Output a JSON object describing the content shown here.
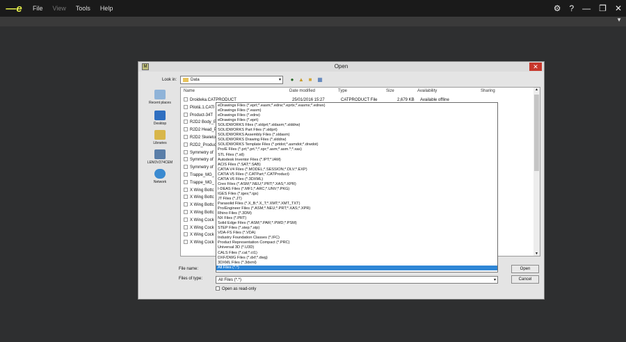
{
  "app": {
    "logo_text": "e",
    "menus": [
      "File",
      "View",
      "Tools",
      "Help"
    ],
    "window_controls": [
      "⚙",
      "?",
      "—",
      "❐",
      "✕"
    ],
    "colors": {
      "logo": "#e7f04a",
      "selection": "#2f86d6",
      "close_button": "#c7372b"
    }
  },
  "dialog": {
    "title": "Open",
    "look_in_label": "Look in:",
    "look_in_value": "Data",
    "toolbar_icons": [
      "back-icon",
      "up-folder-icon",
      "new-folder-icon",
      "view-menu-icon"
    ],
    "places": [
      "Recent places",
      "Desktop",
      "Libraries",
      "LENOV274CEM",
      "Network"
    ],
    "columns": [
      "Name",
      "Date modified",
      "Type",
      "Size",
      "Availability",
      "Sharing"
    ],
    "files": [
      {
        "name": "Droideka.CATPRODUCT",
        "date": "25/01/2016 15:27",
        "type": "CATPRODUCT File",
        "size": "2,679 KB",
        "availability": "Available offline"
      },
      {
        "name": "Pilot&.1.CATI"
      },
      {
        "name": "Product-34T"
      },
      {
        "name": "R2D2 Body_P"
      },
      {
        "name": "R2D2 Head_P"
      },
      {
        "name": "R2D2 Skeleto"
      },
      {
        "name": "R2D2_Produc"
      },
      {
        "name": "Symmetry of"
      },
      {
        "name": "Symmetry of"
      },
      {
        "name": "Symmetry of"
      },
      {
        "name": "Trappe_MG_"
      },
      {
        "name": "Trappe_MG_"
      },
      {
        "name": "X Wing Bottc"
      },
      {
        "name": "X Wing Bottc"
      },
      {
        "name": "X Wing Bottc"
      },
      {
        "name": "X Wing Bottc"
      },
      {
        "name": "X Wing Cock"
      },
      {
        "name": "X Wing Cock"
      },
      {
        "name": "X Wing Cock"
      },
      {
        "name": "X Wing Cock"
      }
    ],
    "file_types": [
      "eDrawings Files (*.eprt;*.easm;*.edrw;*.eprtx;*.easmx;*.edrwx)",
      "eDrawings Files (*.easm)",
      "eDrawings Files (*.edrw)",
      "eDrawings Files (*.eprt)",
      "SOLIDWORKS Files (*.sldprt;*.sldasm;*.slddrw)",
      "SOLIDWORKS Part Files (*.sldprt)",
      "SOLIDWORKS Assembly Files (*.sldasm)",
      "SOLIDWORKS Drawing Files (*.slddrw)",
      "SOLIDWORKS Template Files (*.prtdot;*.asmdot;*.drwdot)",
      "Pro/E Files (*.prt;*.prt.*;*.xpr;*.asm;*.asm.*;*.xas)",
      "STL Files (*.stl)",
      "Autodesk Inventor Files (*.IPT;*.IAM)",
      "ACIS Files (*.SAT;*.SAB)",
      "CATIA V4 Files (*.MODEL;*.SESSION;*.DLV;*.EXP)",
      "CATIA V5 Files (*.CATPart;*.CATProduct)",
      "CATIA V6 Files (*.3DXML)",
      "Creo Files (*.ASM;*.NEU;*.PRT;*.XAS;*.XPR)",
      "I-DEAS Files (*.MF1;*.ARC;*.UNV;*.PKG)",
      "IGES Files (*.iges;*.igs)",
      "JT Files (*.JT)",
      "Parasolid Files (*.X_B;*.X_T;*.XMT;*.XMT_TXT)",
      "Pro/Engineer Files (*.ASM;*.NEU;*.PRT;*.XAS;*.XPR)",
      "Rhino Files (*.3DM)",
      "NX Files (*.PRT)",
      "Solid Edge Files (*.ASM;*.PAR;*.PWD;*.PSM)",
      "STEP Files (*.step;*.stp)",
      "VDA-FS Files (*.VDA)",
      "Industry Foundation Classes (*.IFC)",
      "Product Representation Compact (*.PRC)",
      "Universal 3D (*.U3D)",
      "CALS Files (*.cal;*.ct1)",
      "DXF/DWG Files (*.dxf;*.dwg)",
      "3DXML Files (*.3dxml)",
      "All Files (*.*)"
    ],
    "selected_type_index": 33,
    "file_name_label": "File name:",
    "file_name_value": "",
    "files_of_type_label": "Files of type:",
    "files_of_type_value": "All Files (*.*)",
    "read_only_label": "Open as read-only",
    "open_button": "Open",
    "cancel_button": "Cancel"
  }
}
